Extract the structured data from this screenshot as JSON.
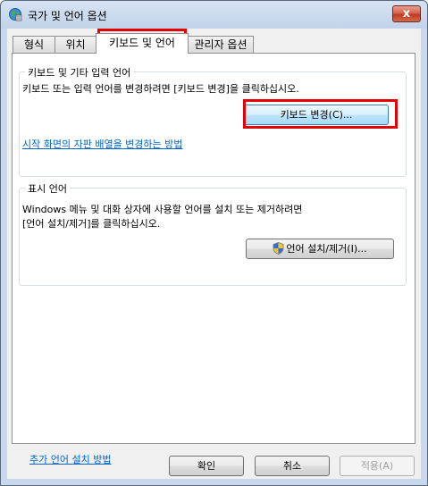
{
  "window": {
    "title": "국가 및 언어 옵션",
    "close_label": "x"
  },
  "tabs": [
    "형식",
    "위치",
    "키보드 및 언어",
    "관리자 옵션"
  ],
  "keyboards_group": {
    "title": "키보드 및 기타 입력 언어",
    "description": "키보드 또는 입력 언어를 변경하려면 [키보드 변경]을 클릭하십시오.",
    "button": "키보드 변경(C)...",
    "link": "시작 화면의 자판 배열을 변경하는 방법"
  },
  "display_group": {
    "title": "표시 언어",
    "description_line1": "Windows 메뉴 및 대화 상자에 사용할 언어를 설치 또는 제거하려면",
    "description_line2": "[언어 설치/제거]를 클릭하십시오.",
    "button": "언어 설치/제거(I)..."
  },
  "bottom_link": "추가 언어 설치 방법",
  "dialog_buttons": {
    "ok": "확인",
    "cancel": "취소",
    "apply": "적용(A)"
  }
}
